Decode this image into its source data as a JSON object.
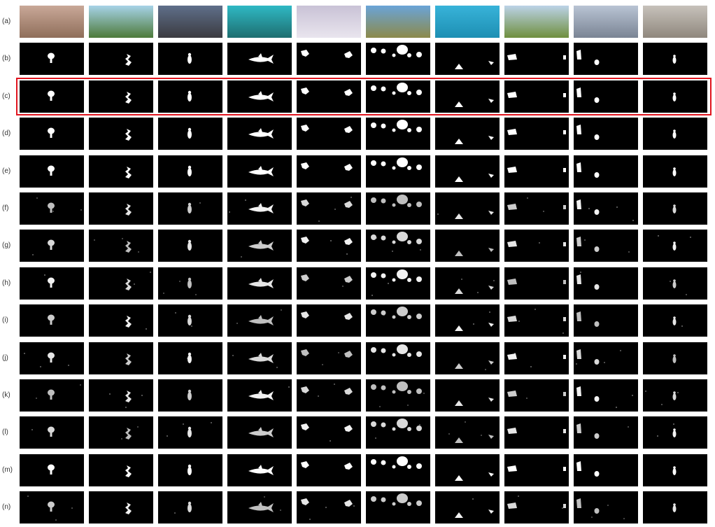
{
  "figure": {
    "row_labels": [
      "(a)",
      "(b)",
      "(c)",
      "(d)",
      "(e)",
      "(f)",
      "(g)",
      "(h)",
      "(i)",
      "(j)",
      "(k)",
      "(l)",
      "(m)",
      "(n)"
    ],
    "highlighted_row": "(c)",
    "highlight_color": "#e0141e",
    "column_count": 10,
    "panorama_row": "(a)",
    "panorama_scenes": [
      "flooded-field-with-trees",
      "green-park-path-with-cyclist",
      "cloudy-sky-street",
      "underwater-turquoise-shark",
      "snowy-mountain-with-dogs",
      "hot-air-balloons-over-field",
      "underwater-diver",
      "grass-field-with-buildings",
      "reflective-metallic-sphere-room",
      "indoor-white-room"
    ],
    "panorama_colors": [
      [
        "#c9a898",
        "#8f6e5a"
      ],
      [
        "#a7d3e8",
        "#4d7a3a"
      ],
      [
        "#5f6f8a",
        "#3b3b40"
      ],
      [
        "#2fb9c4",
        "#1e6e70"
      ],
      [
        "#c9c2d6",
        "#e9e5ee"
      ],
      [
        "#6aa4d8",
        "#8c8a4a"
      ],
      [
        "#38b3d9",
        "#1d8fb3"
      ],
      [
        "#bcd3e8",
        "#6f8f3e"
      ],
      [
        "#b9c4d4",
        "#7a8494"
      ],
      [
        "#c7c2bb",
        "#8f877d"
      ]
    ],
    "mask_foreground_color": "#ffffff",
    "mask_background_color": "#000000"
  }
}
